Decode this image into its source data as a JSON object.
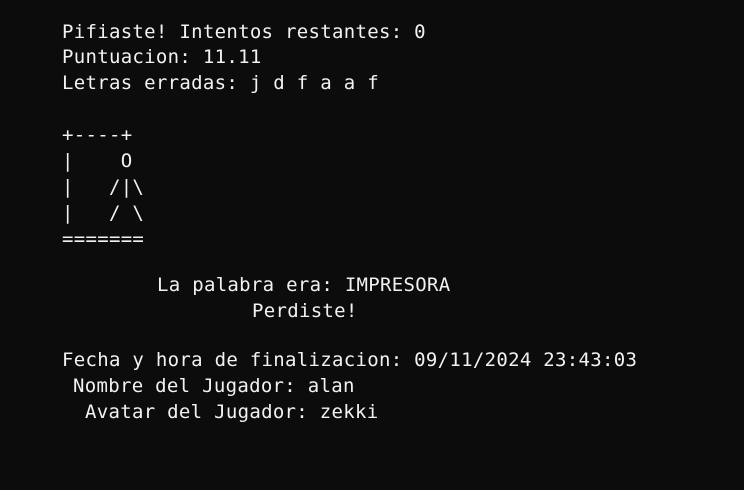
{
  "status": {
    "message": "Pifiaste! Intentos restantes: 0",
    "score": "Puntuacion: 11.11",
    "wrong_letters": "Letras erradas: j d f a a f"
  },
  "hangman_drawing": "+----+\n|    O\n|   /|\\\n|   / \\\n=======",
  "result": {
    "word_reveal": "La palabra era: IMPRESORA",
    "outcome": "Perdiste!"
  },
  "info": {
    "finished_at": "Fecha y hora de finalizacion: 09/11/2024 23:43:03",
    "player_name": "Nombre del Jugador: alan",
    "player_avatar": "Avatar del Jugador: zekki"
  },
  "colors": {
    "background": "#0c0c0c",
    "text": "#f2f2f2"
  }
}
